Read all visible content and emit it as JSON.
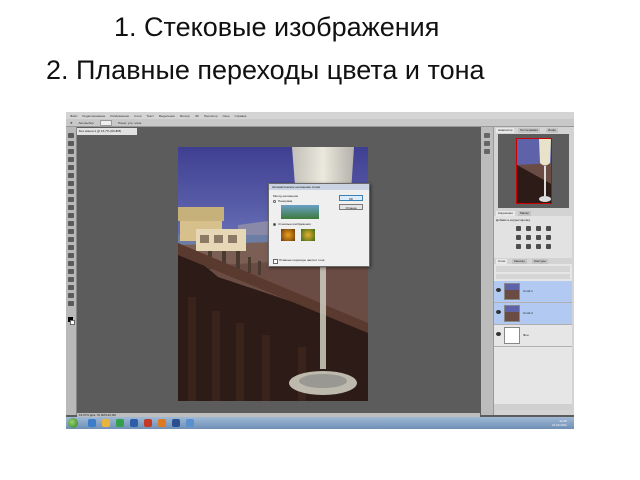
{
  "slide": {
    "line1": "1. Стековые изображения",
    "line2": "2. Плавные переходы цвета и тона"
  },
  "app": {
    "menu": [
      "Файл",
      "Редактирование",
      "Изображение",
      "Слои",
      "Текст",
      "Выделение",
      "Фильтр",
      "3D",
      "Просмотр",
      "Окно",
      "Справка"
    ],
    "options": [
      "Автовыбор",
      "Слой",
      "Показ. упр. элем."
    ],
    "doc_tab": "Без имени-1 @ 16,7% (RGB/8)",
    "status": "16,67%   Док: 70,0M/140,0M",
    "dialog": {
      "title": "Автоматическое наложение слоев",
      "group_label": "Метод наложения",
      "option1": "Панорама",
      "option2": "Стековые изображения",
      "checkbox": "Плавные переходы цвета и тона",
      "ok": "ОК",
      "cancel": "Отмена"
    },
    "panel_tabs": [
      "Навигатор",
      "Гистограмма",
      "Инфо"
    ],
    "adj_tabs": [
      "Коррекция",
      "Маски"
    ],
    "adj_label": "Добавить корректировку",
    "layers_tabs": [
      "Слои",
      "Каналы",
      "Контуры"
    ],
    "layers": [
      {
        "name": "Слой 1",
        "selected": true
      },
      {
        "name": "Слой 2",
        "selected": true
      },
      {
        "name": "Фон",
        "selected": false
      }
    ],
    "clock_time": "12:45",
    "clock_date": "21.04.2011"
  },
  "colors": {
    "ui_dark": "#5c5c5c",
    "selection_blue": "#b2c9f2",
    "taskbar": "#6f8fb5"
  }
}
